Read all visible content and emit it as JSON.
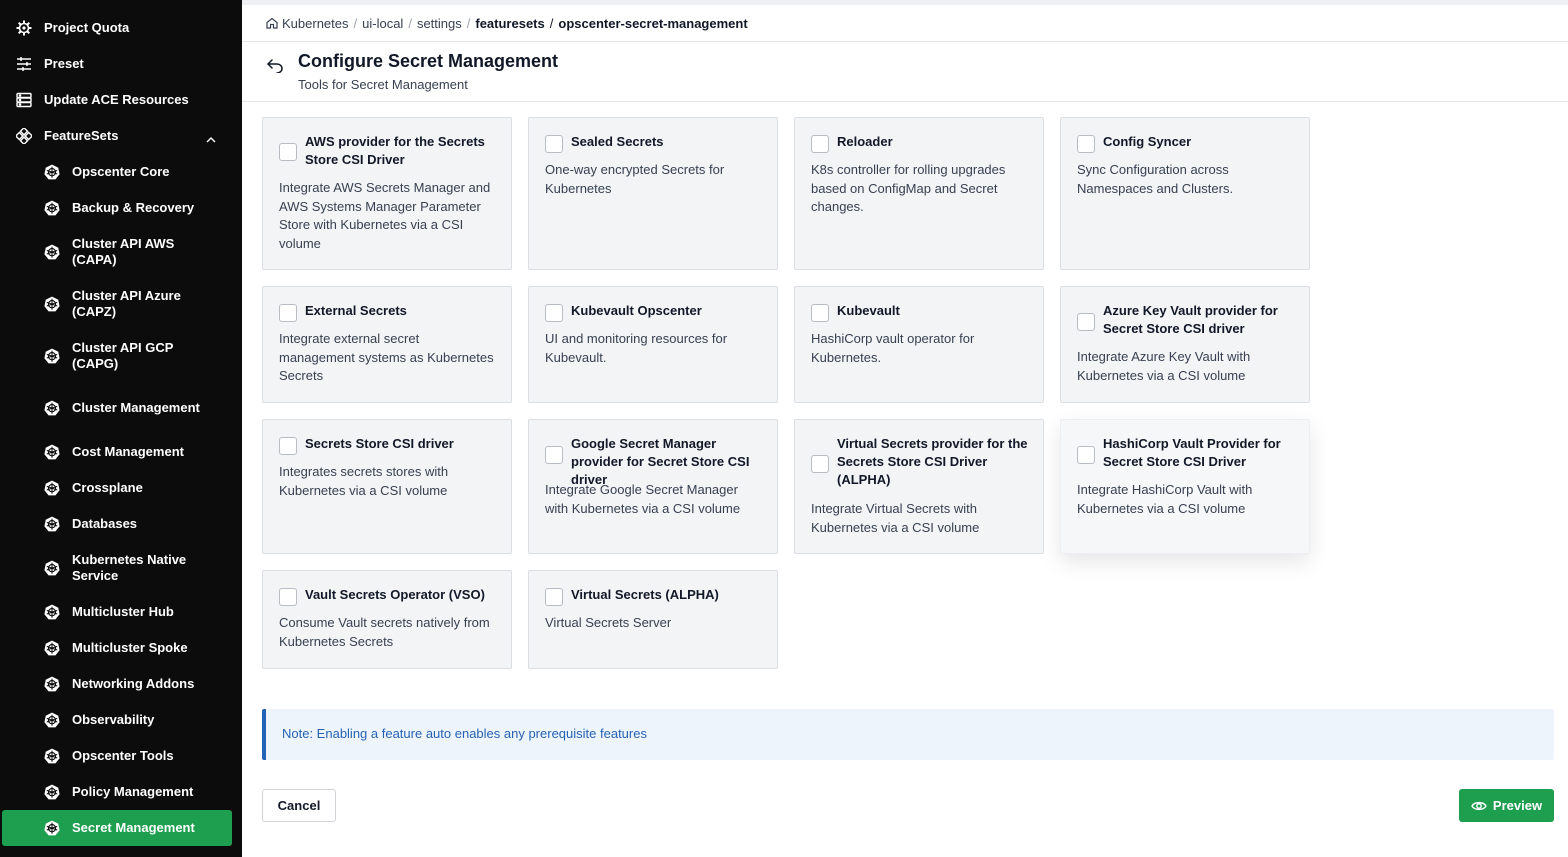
{
  "sidebar": {
    "top_items": [
      {
        "label": "Project Quota",
        "icon": "gear-icon"
      },
      {
        "label": "Preset",
        "icon": "sliders-icon"
      },
      {
        "label": "Update ACE Resources",
        "icon": "server-icon"
      },
      {
        "label": "FeatureSets",
        "icon": "featuresets-icon",
        "expanded": true
      }
    ],
    "featuresets": [
      {
        "label": "Opscenter Core"
      },
      {
        "label": "Backup & Recovery"
      },
      {
        "label": "Cluster API AWS (CAPA)"
      },
      {
        "label": "Cluster API Azure (CAPZ)"
      },
      {
        "label": "Cluster API GCP (CAPG)"
      },
      {
        "label": "Cluster Management"
      },
      {
        "label": "Cost Management"
      },
      {
        "label": "Crossplane"
      },
      {
        "label": "Databases"
      },
      {
        "label": "Kubernetes Native Service"
      },
      {
        "label": "Multicluster Hub"
      },
      {
        "label": "Multicluster Spoke"
      },
      {
        "label": "Networking Addons"
      },
      {
        "label": "Observability"
      },
      {
        "label": "Opscenter Tools"
      },
      {
        "label": "Policy Management"
      },
      {
        "label": "Secret Management",
        "active": true
      }
    ],
    "active_color": "#1e9e4f"
  },
  "breadcrumb": {
    "home_icon": "home-icon",
    "items": [
      "Kubernetes",
      "ui-local",
      "settings",
      "featuresets",
      "opscenter-secret-management"
    ]
  },
  "header": {
    "title": "Configure Secret Management",
    "subtitle": "Tools for Secret Management"
  },
  "features": [
    {
      "title": "AWS provider for the Secrets Store CSI Driver",
      "description": "Integrate AWS Secrets Manager and AWS Systems Manager Parameter Store with Kubernetes via a CSI volume",
      "checked": false
    },
    {
      "title": "Sealed Secrets",
      "description": "One-way encrypted Secrets for Kubernetes",
      "checked": false
    },
    {
      "title": "Reloader",
      "description": "K8s controller for rolling upgrades based on ConfigMap and Secret changes.",
      "checked": false
    },
    {
      "title": "Config Syncer",
      "description": "Sync Configuration across Namespaces and Clusters.",
      "checked": false
    },
    {
      "title": "External Secrets",
      "description": "Integrate external secret management systems as Kubernetes Secrets",
      "checked": false
    },
    {
      "title": "Kubevault Opscenter",
      "description": "UI and monitoring resources for Kubevault.",
      "checked": false
    },
    {
      "title": "Kubevault",
      "description": "HashiCorp vault operator for Kubernetes.",
      "checked": false
    },
    {
      "title": "Azure Key Vault provider for Secret Store CSI driver",
      "description": "Integrate Azure Key Vault with Kubernetes via a CSI volume",
      "checked": false
    },
    {
      "title": "Secrets Store CSI driver",
      "description": "Integrates secrets stores with Kubernetes via a CSI volume",
      "checked": false
    },
    {
      "title": "Google Secret Manager provider for Secret Store CSI driver",
      "description": "Integrate Google Secret Manager with Kubernetes via a CSI volume",
      "checked": false
    },
    {
      "title": "Virtual Secrets provider for the Secrets Store CSI Driver (ALPHA)",
      "description": "Integrate Virtual Secrets with Kubernetes via a CSI volume",
      "checked": false
    },
    {
      "title": "HashiCorp Vault Provider for Secret Store CSI Driver",
      "description": "Integrate HashiCorp Vault with Kubernetes via a CSI volume",
      "checked": false,
      "hovered": true
    },
    {
      "title": "Vault Secrets Operator (VSO)",
      "description": "Consume Vault secrets natively from Kubernetes Secrets",
      "checked": false
    },
    {
      "title": "Virtual Secrets (ALPHA)",
      "description": "Virtual Secrets Server",
      "checked": false
    }
  ],
  "note": "Note: Enabling a feature auto enables any prerequisite features",
  "actions": {
    "cancel_label": "Cancel",
    "preview_label": "Preview",
    "preview_icon": "eye-icon"
  },
  "colors": {
    "primary": "#1e9e4f",
    "note_accent": "#2563b6",
    "sidebar_bg": "#0c0c0c"
  }
}
